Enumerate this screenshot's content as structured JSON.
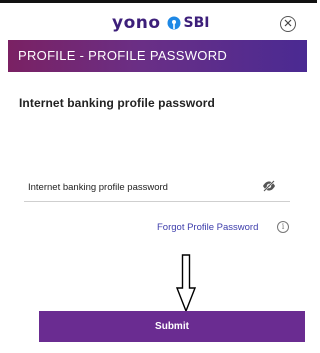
{
  "header": {
    "brand_yono": "yono",
    "brand_sbi": "SBI",
    "brand_icon": "sbi-logo-icon",
    "close_icon": "close-circle-icon"
  },
  "title_bar": {
    "title": "PROFILE - PROFILE PASSWORD"
  },
  "form": {
    "heading": "Internet banking profile password",
    "password_field": {
      "placeholder": "Internet banking profile password",
      "value": "",
      "visibility_icon": "eye-slash-icon"
    },
    "forgot_link": "Forgot Profile Password",
    "info_icon": "info-icon",
    "submit_label": "Submit"
  },
  "annotation": {
    "arrow_icon": "down-arrow-icon"
  },
  "colors": {
    "brand_purple": "#3d1f7a",
    "title_gradient_start": "#7a2163",
    "title_gradient_end": "#4a2a92",
    "submit_bg": "#6a2c91",
    "link": "#3d3dab"
  }
}
